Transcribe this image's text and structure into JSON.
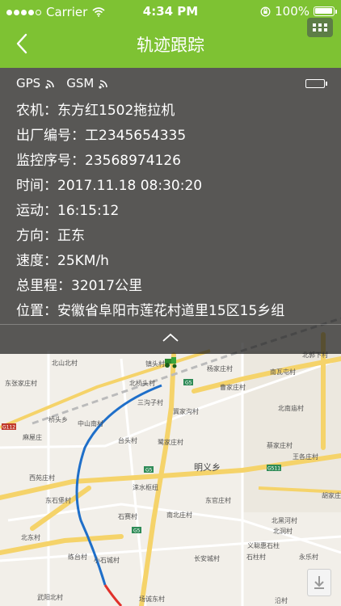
{
  "status_bar": {
    "carrier": "Carrier",
    "time": "4:34 PM",
    "battery_text": "100%",
    "signal_bars": 4,
    "battery_level": 1.0
  },
  "nav": {
    "title": "轨迹跟踪",
    "back_icon": "chevron-left-icon",
    "menu_icon": "grid-icon"
  },
  "device": {
    "signal_labels": [
      "GPS",
      "GSM"
    ],
    "lines": [
      "农机：东方红1502拖拉机",
      "出厂编号：工2345654335",
      "监控序号：23568974126",
      "时间：2017.11.18  08:30:20",
      "运动：16:15:12",
      "方向：正东",
      "速度：25KM/h",
      "总里程：32017公里",
      "位置：安徽省阜阳市莲花村道里15区15乡组"
    ]
  },
  "map": {
    "place_large": [
      "明义乡"
    ],
    "labels_visible": [
      "北山北村",
      "镇头村",
      "杨家庄村",
      "南瓦屯村",
      "北郭下村",
      "东张家庄村",
      "北桥头村",
      "曹家庄村",
      "桥头乡",
      "三沟子村",
      "北南庙村",
      "冀家沟村",
      "中山南村",
      "麻屋庄",
      "台头村",
      "鹭家庄村",
      "蔡家庄村",
      "西苑庄村",
      "王各庄村",
      "胡家庄村",
      "涞水枢纽",
      "东石堡村",
      "东官庄村",
      "石赛村",
      "南北庄村",
      "北黑河村",
      "北洞村",
      "小石城村",
      "北东村",
      "义聪惠石柱",
      "练台村",
      "石柱村",
      "永乐村",
      "长安城村",
      "武阳北村",
      "场诚东村",
      "沿村"
    ],
    "road_badges": [
      "G5",
      "G5",
      "G5",
      "G5",
      "G511",
      "G112"
    ]
  },
  "colors": {
    "brand_green": "#7ec233",
    "overlay": "#1c1c1c",
    "track_blue": "#1f6fc9",
    "track_red": "#e0312b"
  }
}
